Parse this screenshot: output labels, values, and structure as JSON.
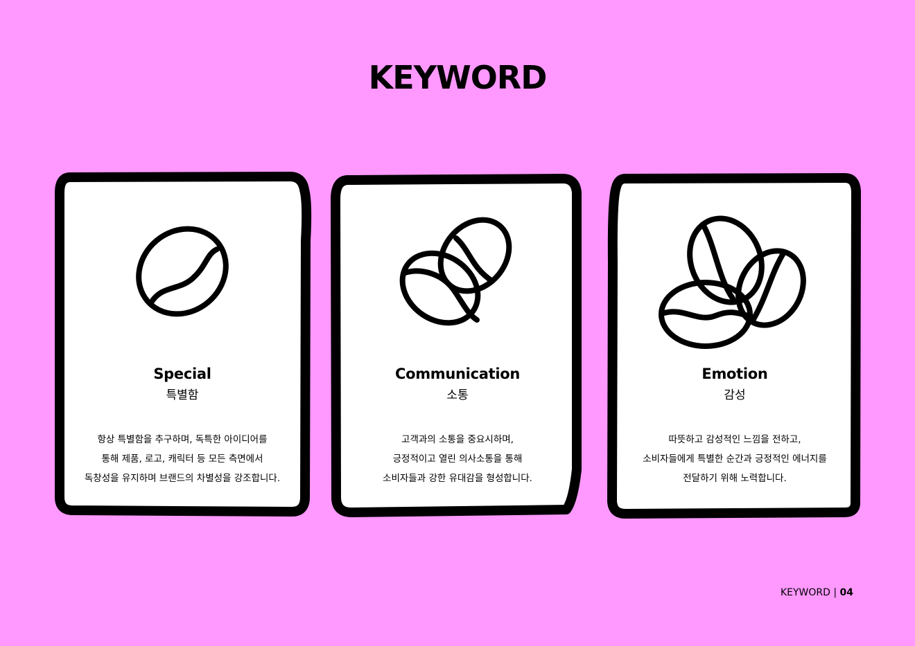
{
  "page": {
    "title": "KEYWORD",
    "background_color": "#ff99ff",
    "card_color": "#ffffff",
    "outline_color": "#000000"
  },
  "cards": [
    {
      "icon": "coffee-bean-icon",
      "title": "Special",
      "subtitle": "특별함",
      "description": [
        "항상 특별함을 추구하며, 독특한 아이디어를",
        "통해 제품, 로고, 캐릭터 등 모든 측면에서",
        "독창성을 유지하며 브랜드의 차별성을 강조합니다."
      ]
    },
    {
      "icon": "two-coffee-beans-icon",
      "title": "Communication",
      "subtitle": "소통",
      "description": [
        "고객과의 소통을 중요시하며,",
        "긍정적이고 열린 의사소통을 통해",
        "소비자들과 강한 유대감을 형성합니다."
      ]
    },
    {
      "icon": "three-coffee-beans-icon",
      "title": "Emotion",
      "subtitle": "감성",
      "description": [
        "따뜻하고 감성적인 느낌을 전하고,",
        "소비자들에게 특별한 순간과 긍정적인 에너지를",
        "전달하기 위해 노력합니다."
      ]
    }
  ],
  "footer": {
    "label": "KEYWORD",
    "separator": "|",
    "page_number": "04"
  }
}
